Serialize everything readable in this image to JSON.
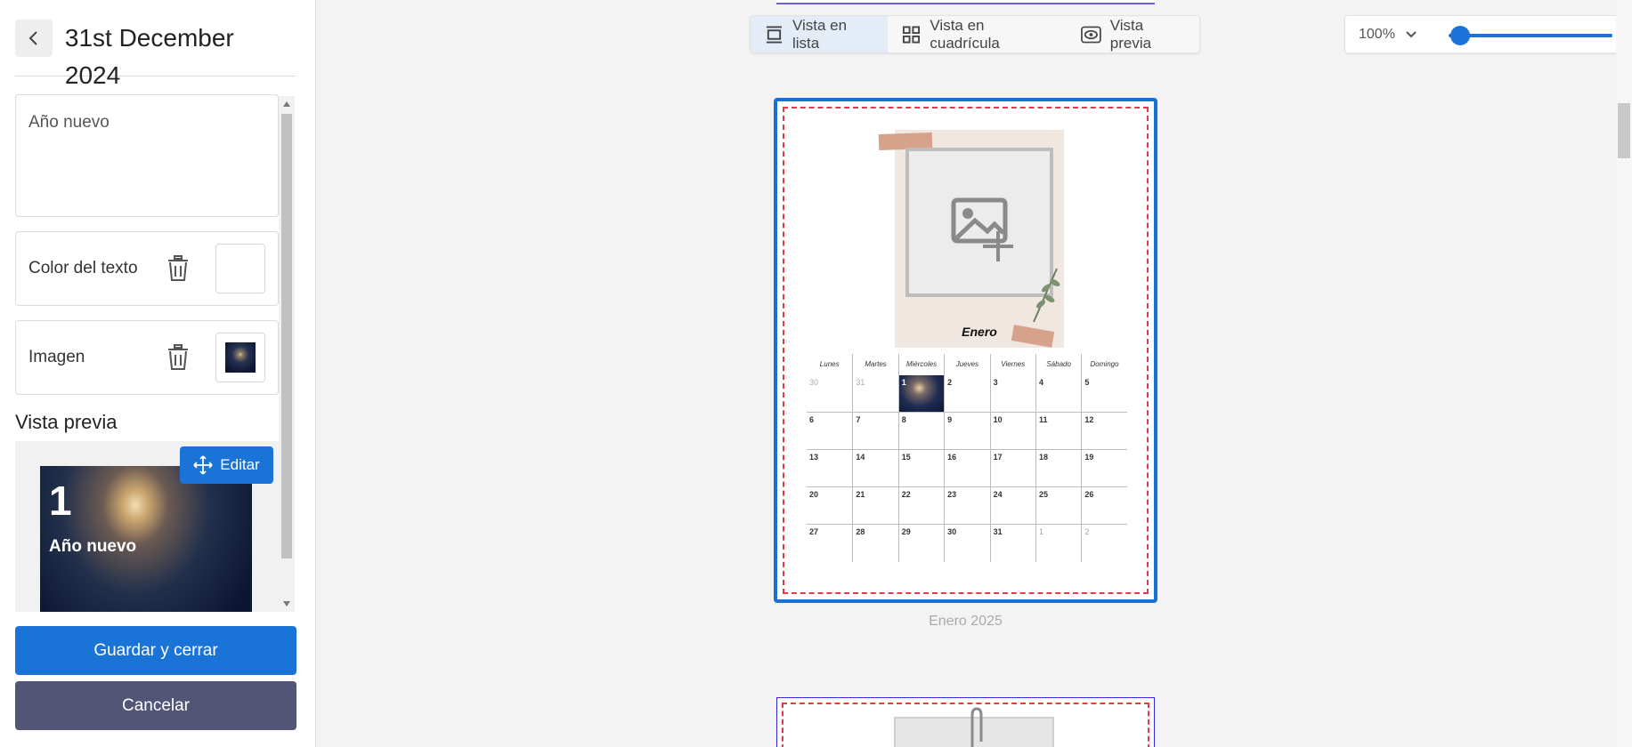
{
  "sidebar": {
    "title": "31st December 2024",
    "back_icon": "chevron-left-icon",
    "text_value": "Año nuevo",
    "text_color_label": "Color del texto",
    "image_label": "Imagen",
    "preview_label": "Vista previa",
    "preview_number": "1",
    "preview_text": "Año nuevo",
    "edit_label": "Editar",
    "save_label": "Guardar y cerrar",
    "cancel_label": "Cancelar"
  },
  "toolbar": {
    "views": [
      {
        "label": "Vista en lista",
        "icon": "list-view-icon",
        "active": true
      },
      {
        "label": "Vista en cuadrícula",
        "icon": "grid-view-icon",
        "active": false
      },
      {
        "label": "Vista previa",
        "icon": "eye-icon",
        "active": false
      }
    ],
    "zoom": "100%",
    "zoom_fraction": 0.0
  },
  "page": {
    "month_title": "Enero",
    "caption": "Enero 2025",
    "weekdays": [
      "Lunes",
      "Martes",
      "Miércoles",
      "Jueves",
      "Viernes",
      "Sábado",
      "Domingo"
    ],
    "weeks": [
      [
        "30",
        "31",
        "1",
        "2",
        "3",
        "4",
        "5"
      ],
      [
        "6",
        "7",
        "8",
        "9",
        "10",
        "11",
        "12"
      ],
      [
        "13",
        "14",
        "15",
        "16",
        "17",
        "18",
        "19"
      ],
      [
        "20",
        "21",
        "22",
        "23",
        "24",
        "25",
        "26"
      ],
      [
        "27",
        "28",
        "29",
        "30",
        "31",
        "1",
        "2"
      ]
    ]
  },
  "colors": {
    "accent": "#1a73d6",
    "cancel": "#535576",
    "bleed_line": "#e23a4d"
  }
}
